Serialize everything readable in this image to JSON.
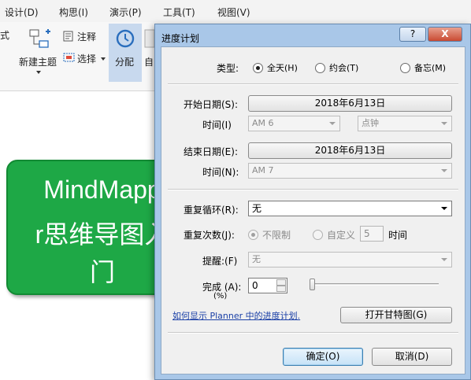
{
  "menubar": {
    "items": [
      "设计(D)",
      "构思(I)",
      "演示(P)",
      "工具(T)",
      "视图(V)"
    ]
  },
  "ribbon": {
    "cut_label": "式",
    "new_topic": "新建主题",
    "note": "注释",
    "select": "选择",
    "assign": "分配",
    "auto_cut": "自"
  },
  "canvas": {
    "topic_lines": [
      "MindMapp",
      "r思维导图入",
      "门"
    ]
  },
  "dialog": {
    "title": "进度计划",
    "title_buttons": {
      "help": "?",
      "close": "X"
    },
    "type_label": "类型:",
    "type_options": [
      "全天(H)",
      "约会(T)",
      "备忘(M)"
    ],
    "type_selected": "全天(H)",
    "start_date_label": "开始日期(S):",
    "start_date": "2018年6月13日",
    "start_time_label": "时间(I)",
    "start_time": "AM 6",
    "start_minute": "点钟",
    "end_date_label": "结束日期(E):",
    "end_date": "2018年6月13日",
    "end_time_label": "时间(N):",
    "end_time": "AM 7",
    "recurrence_label": "重复循环(R):",
    "recurrence": "无",
    "repeat_count_label": "重复次数(J):",
    "repeat_unlimited": "不限制",
    "repeat_custom": "自定义",
    "repeat_value": "5",
    "repeat_unit": "时间",
    "reminder_label": "提醒:(F)",
    "reminder": "无",
    "complete_label": "完成 (A):",
    "complete_unit": "(%)",
    "complete_value": "0",
    "planner_link": "如何显示 Planner 中的进度计划.",
    "gantt_button": "打开甘特图(G)",
    "ok_button": "确定(O)",
    "cancel_button": "取消(D)"
  }
}
